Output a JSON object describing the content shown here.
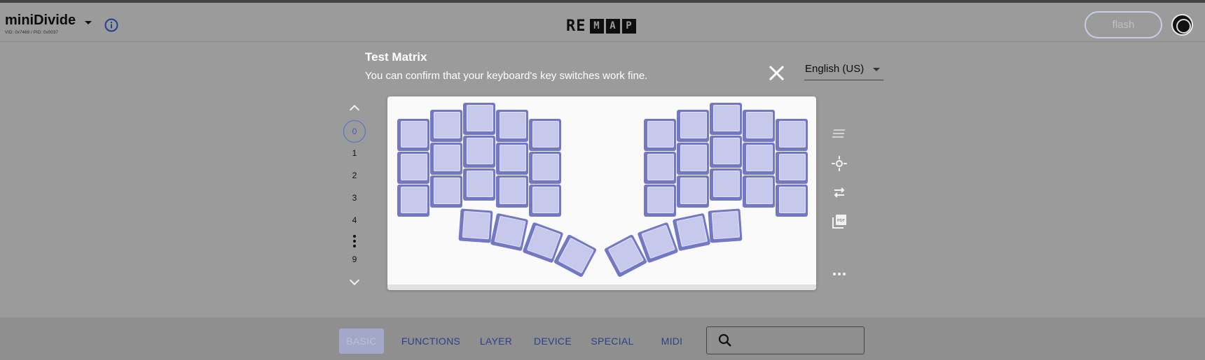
{
  "header": {
    "keyboard_name": "miniDivide",
    "keyboard_ids": "VID: 0x7469 / PID: 0x0037",
    "logo_prefix": "RE",
    "logo_boxes": [
      "M",
      "A",
      "P"
    ],
    "flash_label": "flash"
  },
  "dialog": {
    "title": "Test Matrix",
    "subtitle": "You can confirm that your keyboard's key switches work fine.",
    "language": "English (US)"
  },
  "layers": {
    "items": [
      "0",
      "1",
      "2",
      "3",
      "4",
      "9"
    ],
    "active": "0"
  },
  "keyboard": {
    "total_keys": 38,
    "key_color": "#7378c4",
    "keycap_color": "#c6c8ec"
  },
  "toolbar": {
    "icons": [
      "lines-icon",
      "brightness-icon",
      "swap-icon",
      "pdf-icon",
      "more-icon"
    ]
  },
  "tabs": {
    "items": [
      "BASIC",
      "FUNCTIONS",
      "LAYER",
      "DEVICE",
      "SPECIAL",
      "MIDI"
    ],
    "active": "BASIC"
  },
  "search": {
    "placeholder": ""
  },
  "colors": {
    "accent": "#3c5cc5",
    "overlay": "#9b9b9b"
  }
}
